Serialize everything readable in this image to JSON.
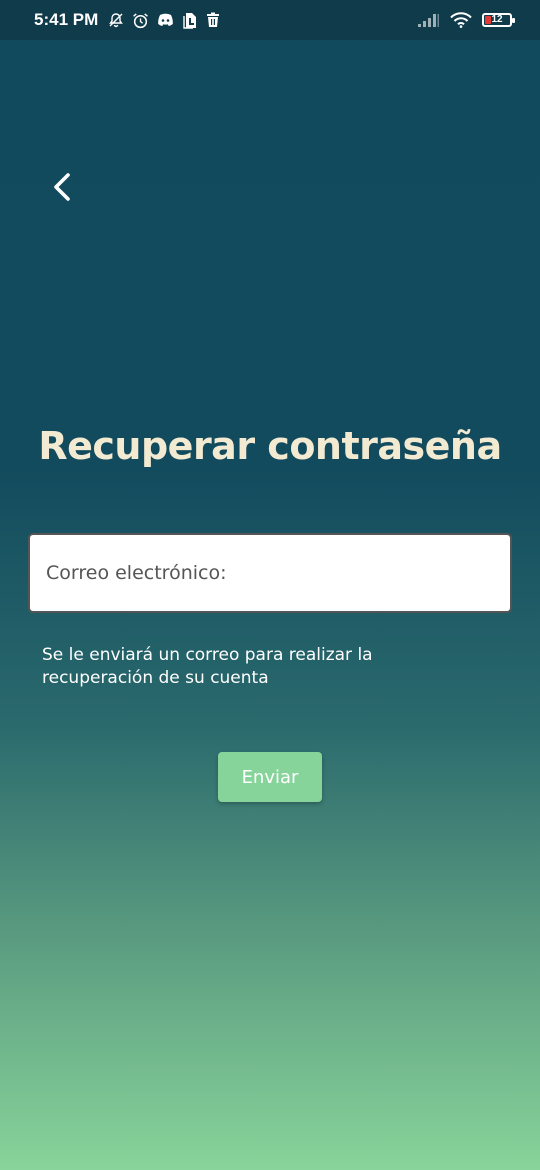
{
  "status_bar": {
    "time": "5:41 PM",
    "left_icons": [
      "notifications-off-icon",
      "alarm-icon",
      "discord-icon",
      "file-icon",
      "trash-icon"
    ],
    "right_icons": [
      "signal-icon",
      "wifi-icon",
      "battery-icon"
    ],
    "battery_level": "12",
    "battery_color": "#e53935"
  },
  "header": {
    "back_icon": "chevron-left-icon"
  },
  "main": {
    "title": "Recuperar contraseña",
    "email_placeholder": "Correo electrónico:",
    "helper_text": "Se le enviará un correo para realizar la recuperación de su cuenta",
    "send_label": "Enviar"
  },
  "colors": {
    "background_top": "#124a5d",
    "background_bottom": "#88d49a",
    "title": "#f3ead2",
    "button": "#86d49a"
  }
}
